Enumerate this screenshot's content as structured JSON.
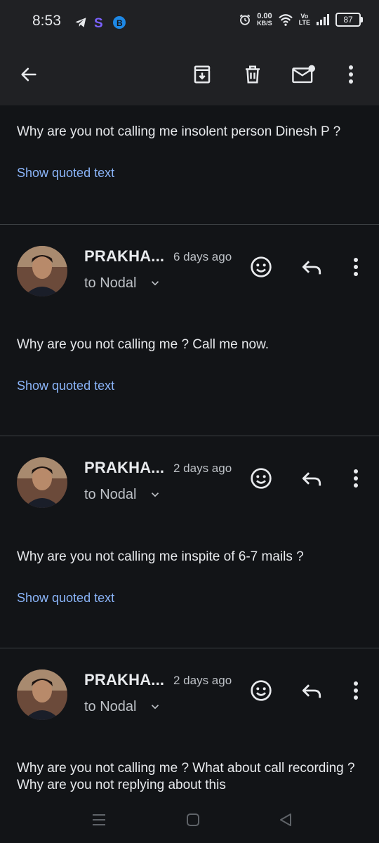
{
  "status_bar": {
    "time": "8:53",
    "left_icons": [
      "telegram-icon",
      "s-app-icon",
      "b-app-icon"
    ],
    "net_speed_value": "0.00",
    "net_speed_unit": "KB/S",
    "volte_top": "Vo",
    "volte_bottom": "LTE",
    "battery": "87"
  },
  "toolbar": {
    "back_icon": "arrow-back-icon",
    "archive_icon": "archive-icon",
    "delete_icon": "delete-icon",
    "mark_unread_icon": "mark-unread-icon",
    "more_icon": "more-vert-icon"
  },
  "messages": [
    {
      "sender": "",
      "time": "",
      "recipient": "",
      "body": "Why are you not calling me insolent person Dinesh P ?",
      "quoted_link": "Show quoted text"
    },
    {
      "sender": "PRAKHA...",
      "time": "6 days ago",
      "recipient": "to Nodal",
      "body": "Why are you not calling me ? Call me now.",
      "quoted_link": "Show quoted text"
    },
    {
      "sender": "PRAKHA...",
      "time": "2 days ago",
      "recipient": "to Nodal",
      "body": "Why are you not calling me inspite of 6-7 mails ?",
      "quoted_link": "Show quoted text"
    },
    {
      "sender": "PRAKHA...",
      "time": "2 days ago",
      "recipient": "to Nodal",
      "body": "Why are you not calling me ? What about call recording ? Why are you not replying about this",
      "quoted_link": ""
    }
  ],
  "colors": {
    "background": "#121417",
    "toolbar": "#202124",
    "link": "#8ab4f8",
    "divider": "#3c4043"
  }
}
